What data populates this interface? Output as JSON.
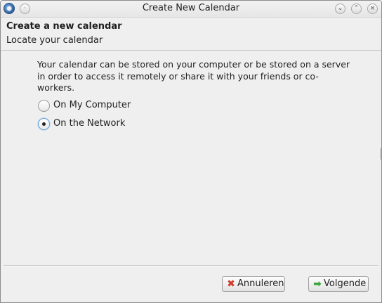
{
  "window": {
    "title": "Create New Calendar"
  },
  "header": {
    "title": "Create a new calendar",
    "subtitle": "Locate your calendar"
  },
  "content": {
    "description": "Your calendar can be stored on your computer or be stored on a server in order to access it remotely or share it with your friends or co-workers.",
    "options": [
      {
        "label": "On My Computer",
        "checked": false
      },
      {
        "label": "On the Network",
        "checked": true
      }
    ]
  },
  "buttons": {
    "cancel_label": "Annuleren",
    "next_label": "Volgende"
  },
  "icons": {
    "app": "thunderbird-app-icon",
    "cancel": "red-x-icon",
    "next": "green-arrow-right-icon"
  },
  "colors": {
    "cancel_icon": "#d23a2b",
    "next_icon": "#3aa53a",
    "radio_focus": "#6fa3d8"
  }
}
